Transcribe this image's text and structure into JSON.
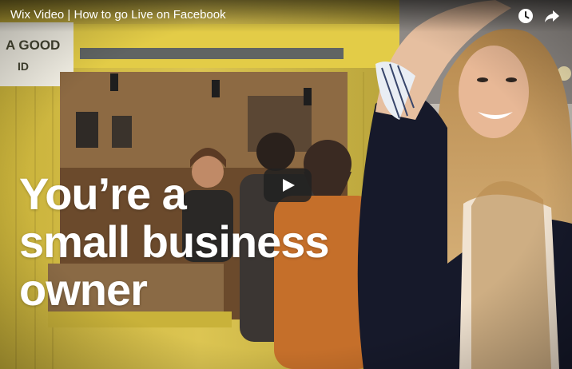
{
  "video": {
    "title": "Wix Video | How to go Live on Facebook",
    "overlay_lines": [
      "You’re a",
      "small business",
      "owner"
    ],
    "sign_text": [
      "A GOOD",
      "ID"
    ]
  },
  "controls": {
    "watch_later": "clock-icon",
    "share": "share-arrow-icon",
    "play": "play-icon"
  },
  "colors": {
    "play_button_bg": "#212121",
    "title_text": "#ffffff",
    "kiosk_yellow": "#e8c93a"
  }
}
